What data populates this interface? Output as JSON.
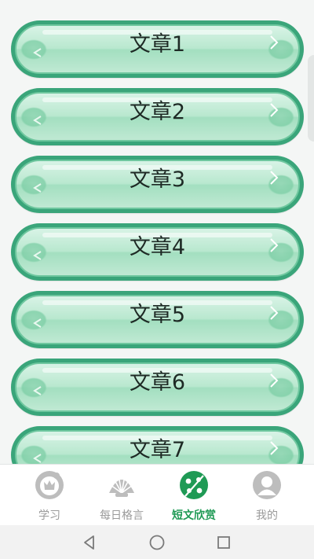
{
  "articles": [
    {
      "label": "文章1"
    },
    {
      "label": "文章2"
    },
    {
      "label": "文章3"
    },
    {
      "label": "文章4"
    },
    {
      "label": "文章5"
    },
    {
      "label": "文章6"
    },
    {
      "label": "文章7"
    }
  ],
  "tabbar": {
    "tabs": [
      {
        "label": "学习",
        "icon": "study-icon"
      },
      {
        "label": "每日格言",
        "icon": "shell-icon"
      },
      {
        "label": "短文欣赏",
        "icon": "essay-icon",
        "active": true
      },
      {
        "label": "我的",
        "icon": "profile-icon"
      }
    ]
  },
  "navbar": {
    "buttons": [
      "back",
      "home",
      "recents"
    ]
  },
  "colors": {
    "button_green": "#3aa57a",
    "active_tab": "#1f9a55",
    "inactive_tab": "#9a9a9a"
  }
}
